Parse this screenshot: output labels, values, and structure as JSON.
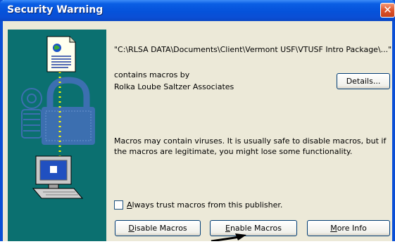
{
  "dialog": {
    "title": "Security Warning",
    "close_glyph": "✕",
    "file_path": "\"C:\\RLSA DATA\\Documents\\Client\\Vermont USF\\VTUSF Intro Package\\...\"",
    "contains_macros_by": "contains macros by",
    "publisher": "Rolka Loube Saltzer Associates",
    "warning_text": "Macros may contain viruses. It is usually safe to disable macros, but if the macros are legitimate, you might lose some functionality.",
    "always_trust_label": "lways trust macros from this publisher.",
    "always_trust_accel": "A",
    "always_trust_checked": false
  },
  "buttons": {
    "details_pre": "Details...",
    "disable_pre": "",
    "disable_accel": "D",
    "disable_post": "isable Macros",
    "enable_accel": "E",
    "enable_post": "nable Macros",
    "more_accel": "M",
    "more_post": "ore Info"
  },
  "icons": [
    "document-icon",
    "lock-icon",
    "keys-icon",
    "computer-icon",
    "arrow-pointer"
  ],
  "colors": {
    "title_bar": "#0a4fd6",
    "art_panel": "#0b7070",
    "dialog_bg": "#ece9d8",
    "close_button": "#e0532a"
  }
}
